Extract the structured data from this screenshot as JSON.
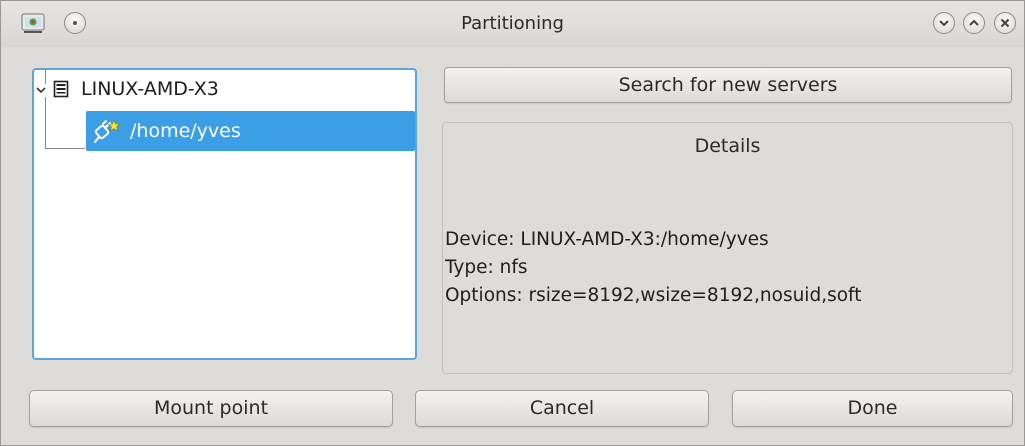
{
  "window": {
    "title": "Partitioning",
    "controls": [
      "minimize-icon",
      "maximize-icon",
      "close-icon"
    ]
  },
  "tree": {
    "root": {
      "label": "LINUX-AMD-X3",
      "icon": "computer-icon",
      "expanded": true
    },
    "children": [
      {
        "label": "/home/yves",
        "icon": "network-share-icon",
        "selected": true
      }
    ]
  },
  "actions": {
    "search_label": "Search for new servers",
    "mount_point_label": "Mount point",
    "cancel_label": "Cancel",
    "done_label": "Done"
  },
  "details": {
    "title": "Details",
    "device": "Device: LINUX-AMD-X3:/home/yves",
    "type": "Type: nfs",
    "options": "Options: rsize=8192,wsize=8192,nosuid,soft"
  },
  "colors": {
    "selection": "#3c9ee4",
    "focus_border": "#5ca4dc",
    "window_bg": "#dedcd9"
  }
}
